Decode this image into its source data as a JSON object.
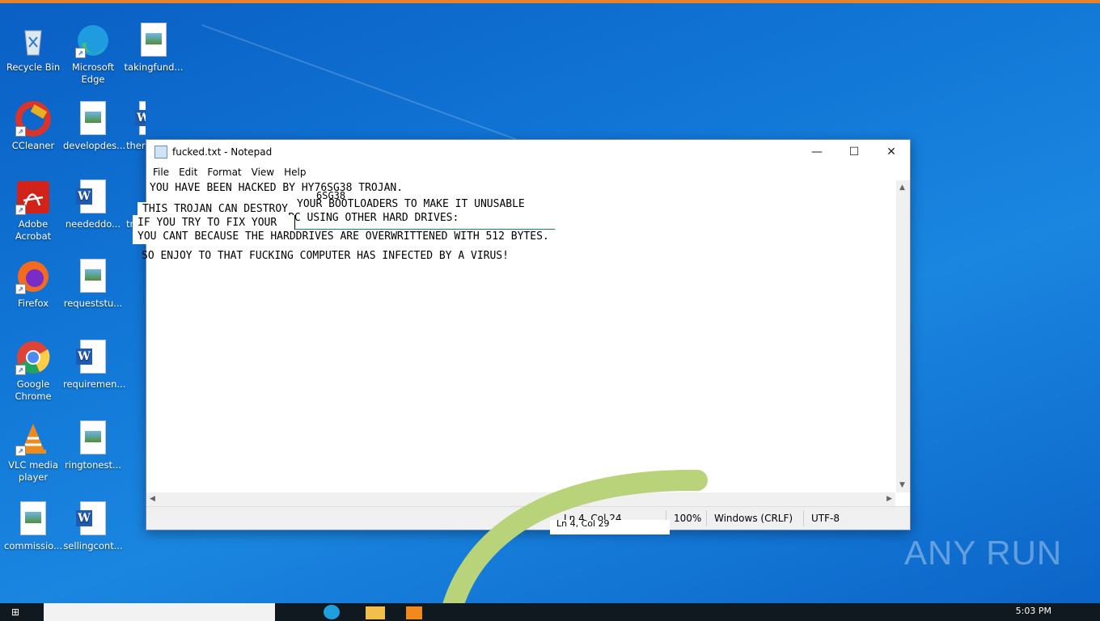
{
  "desktop": {
    "icons": [
      {
        "label": "Recycle Bin"
      },
      {
        "label": "Microsoft Edge"
      },
      {
        "label": "takingfund..."
      },
      {
        "label": "CCleaner"
      },
      {
        "label": "developdes..."
      },
      {
        "label": "ther"
      },
      {
        "label": "Adobe Acrobat"
      },
      {
        "label": "neededdo..."
      },
      {
        "label": "tr"
      },
      {
        "label": "Firefox"
      },
      {
        "label": "requeststu..."
      },
      {
        "label": "Google Chrome"
      },
      {
        "label": "requiremen..."
      },
      {
        "label": "VLC media player"
      },
      {
        "label": "ringtonest..."
      },
      {
        "label": "commissio..."
      },
      {
        "label": "sellingcont..."
      }
    ]
  },
  "notepad": {
    "title": "fucked.txt - Notepad",
    "menu": [
      "File",
      "Edit",
      "Format",
      "View",
      "Help"
    ],
    "lines": [
      "YOU HAVE BEEN HACKED BY HY76SG38 TROJAN.",
      "THIS TROJAN CAN DESTROY",
      "PC USING OTHER HARD DRIVES:",
      "IF YOU TRY TO FIX YOUR",
      "YOU CANT BECAUSE THE HARDDRIVES ARE OVERWRITTENED WITH 512 BYTES.",
      "SO ENJOY TO THAT FUCKING COMPUTER HAS INFECTED BY A VIRUS!"
    ],
    "ghost_lines": [
      "6SG38",
      "YOUR BOOTLOADERS TO MAKE IT UNUSABLE"
    ],
    "status": {
      "position": "Ln 4, Col 24",
      "position_ghost": "Ln 4, Col 29",
      "zoom": "100%",
      "line_ending": "Windows (CRLF)",
      "encoding": "UTF-8"
    }
  },
  "watermark": "ANY RUN",
  "taskbar": {
    "time": "5:03 PM"
  },
  "colors": {
    "desktop": "#1176d6",
    "selection": "#1d73c7",
    "arc": "#b8d37a"
  }
}
